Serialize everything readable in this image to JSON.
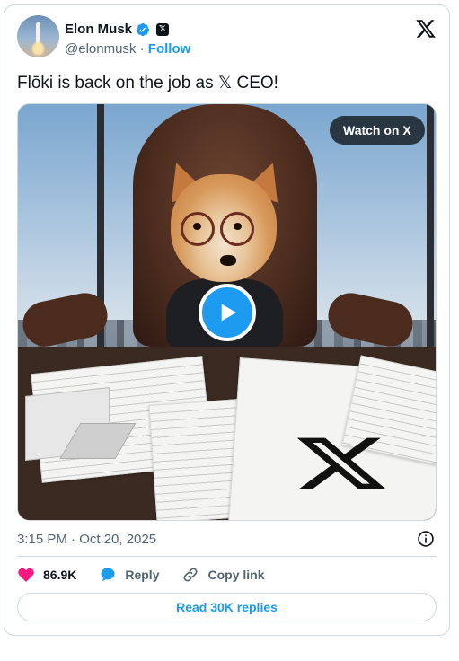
{
  "author": {
    "name": "Elon Musk",
    "handle": "@elonmusk",
    "separator": "·",
    "follow_label": "Follow",
    "affiliate_badge": "𝕏"
  },
  "tweet": {
    "text": "Flōki is back on the job as 𝕏 CEO!",
    "timestamp": "3:15 PM · Oct 20, 2025"
  },
  "media": {
    "watch_label": "Watch on X"
  },
  "actions": {
    "like_count": "86.9K",
    "reply_label": "Reply",
    "copy_link_label": "Copy link"
  },
  "read_replies_label": "Read 30K replies",
  "colors": {
    "accent": "#1d9bf0",
    "like": "#f91880",
    "text": "#0f1419",
    "muted": "#536471",
    "border": "#cfd9de"
  },
  "icons": [
    "x-logo-icon",
    "verified-icon",
    "play-icon",
    "info-icon",
    "heart-icon",
    "reply-icon",
    "link-icon"
  ]
}
